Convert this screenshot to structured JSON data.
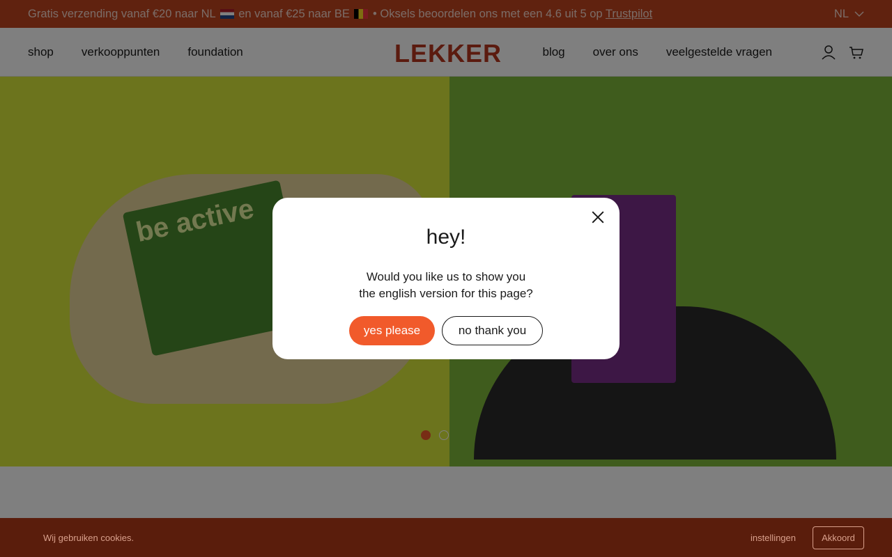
{
  "announcement": {
    "text_part1": "Gratis verzending vanaf €20 naar NL",
    "text_part2": "en vanaf €25 naar BE",
    "text_part3": "• Oksels beoordelen ons met een 4.6 uit 5 op",
    "trustpilot_link": "Trustpilot",
    "language": "NL"
  },
  "header": {
    "logo": "LEKKER",
    "nav_left": [
      "shop",
      "verkooppunten",
      "foundation"
    ],
    "nav_right": [
      "blog",
      "over ons",
      "veelgestelde vragen"
    ]
  },
  "hero": {
    "pack_text": "be active",
    "slide_count": 2,
    "active_slide": 1
  },
  "modal": {
    "title": "hey!",
    "question_line1": "Would you like us to show you",
    "question_line2": "the english version for this page?",
    "yes_label": "yes please",
    "no_label": "no thank you"
  },
  "cookie": {
    "text": "Wij gebruiken cookies.",
    "settings_label": "instellingen",
    "accept_label": "Akkoord"
  },
  "colors": {
    "brand_red": "#c0451f",
    "accent_orange": "#f15a2b",
    "cookie_bg": "#5a1d0c"
  }
}
